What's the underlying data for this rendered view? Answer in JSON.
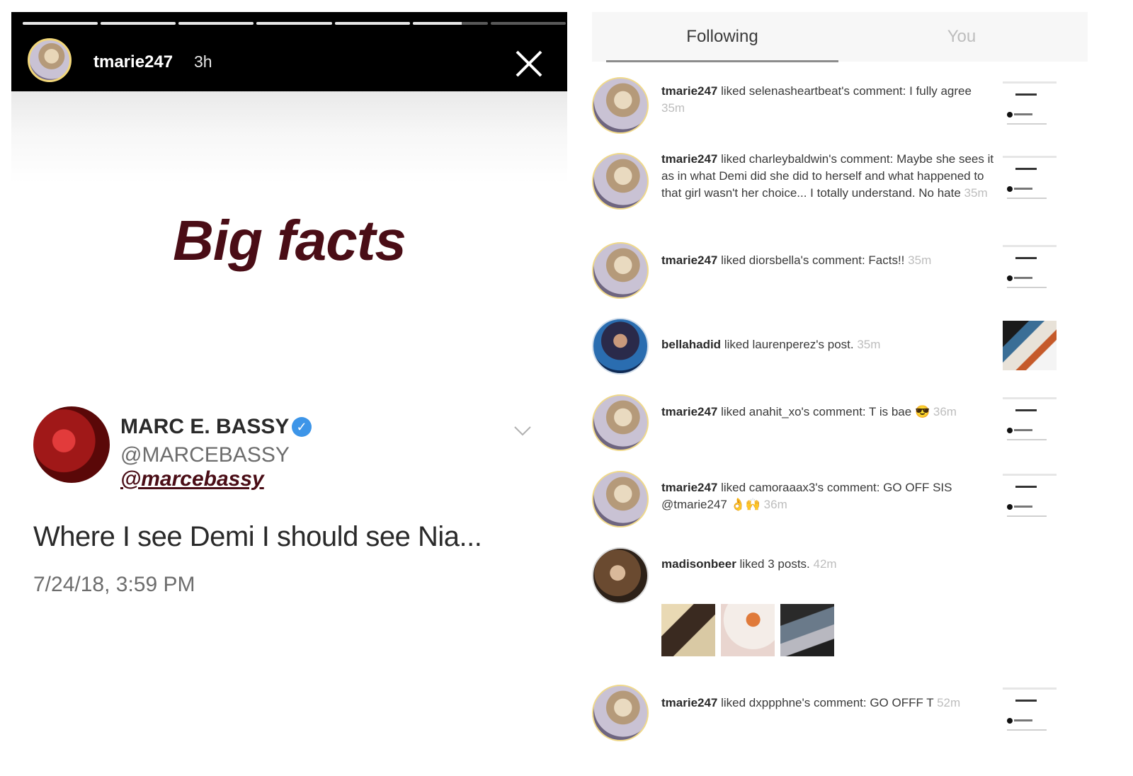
{
  "story": {
    "username": "tmarie247",
    "time": "3h",
    "progress": [
      1,
      1,
      1,
      1,
      1,
      0.65,
      0
    ],
    "headline": "Big facts",
    "tweet": {
      "name": "MARC E. BASSY",
      "handle": "@MARCEBASSY",
      "mention": "@marcebassy",
      "text": "Where I see Demi I should see Nia...",
      "date": "7/24/18, 3:59 PM"
    },
    "icons": {
      "close": "close-icon",
      "verified": "verified-badge-icon",
      "chevron": "chevron-down-icon"
    }
  },
  "activity": {
    "tabs": [
      {
        "label": "Following",
        "active": true
      },
      {
        "label": "You",
        "active": false
      }
    ],
    "items": [
      {
        "user": "tmarie247",
        "text": "liked selenasheartbeat's comment: I fully agree",
        "time": "35m"
      },
      {
        "user": "tmarie247",
        "text": "liked charleybaldwin's comment: Maybe she sees it as in what Demi did she did to herself and what happened to that girl wasn't her choice... I totally understand. No hate",
        "time": "35m"
      },
      {
        "user": "tmarie247",
        "text": "liked diorsbella's comment: Facts!!",
        "time": "35m"
      },
      {
        "user": "bellahadid",
        "text": "liked laurenperez's post.",
        "time": "35m"
      },
      {
        "user": "tmarie247",
        "text": "liked anahit_xo's comment: T is bae 😎",
        "time": "36m"
      },
      {
        "user": "tmarie247",
        "text": "liked camoraaax3's comment: GO OFF SIS @tmarie247 👌🙌",
        "time": "36m"
      },
      {
        "user": "madisonbeer",
        "text": "liked 3 posts.",
        "time": "42m"
      },
      {
        "user": "tmarie247",
        "text": "liked dxppphne's comment: GO OFFF T",
        "time": "52m"
      }
    ]
  },
  "colors": {
    "headline": "#4a0d16",
    "verified": "#3d95e8",
    "story_ring": "#f2d77a"
  }
}
